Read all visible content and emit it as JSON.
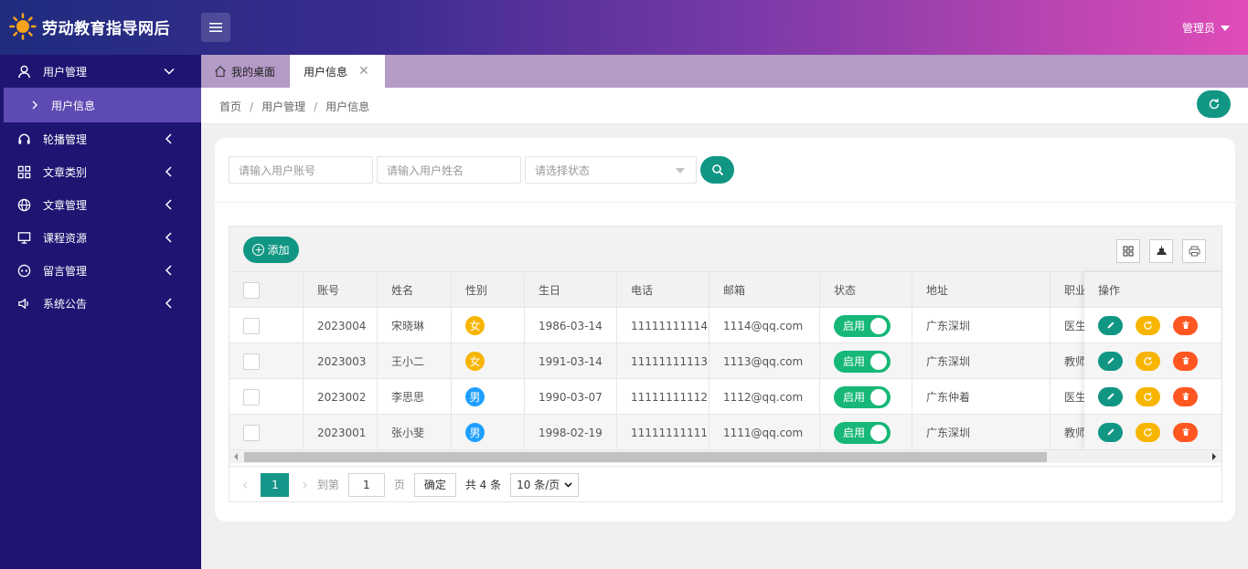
{
  "header": {
    "logo_text": "劳动教育指导网后",
    "admin_label": "管理员",
    "brand_gradient": [
      "#1f2c7e",
      "#e04cb8"
    ]
  },
  "sidebar": {
    "groups": [
      {
        "label": "用户管理",
        "icon": "user-icon",
        "expanded": true
      },
      {
        "label": "轮播管理",
        "icon": "headset-icon"
      },
      {
        "label": "文章类别",
        "icon": "grid-icon"
      },
      {
        "label": "文章管理",
        "icon": "globe-icon"
      },
      {
        "label": "课程资源",
        "icon": "monitor-icon"
      },
      {
        "label": "留言管理",
        "icon": "game-icon"
      },
      {
        "label": "系统公告",
        "icon": "speaker-icon"
      }
    ],
    "sub_item": "用户信息"
  },
  "tabs": {
    "home": "我的桌面",
    "active": "用户信息",
    "close": "✕"
  },
  "breadcrumb": {
    "items": [
      "首页",
      "用户管理",
      "用户信息"
    ],
    "sep": "/"
  },
  "search": {
    "account_placeholder": "请输入用户账号",
    "name_placeholder": "请输入用户姓名",
    "status_placeholder": "请选择状态"
  },
  "toolbar": {
    "add_label": "添加"
  },
  "table": {
    "columns": [
      "账号",
      "姓名",
      "性别",
      "生日",
      "电话",
      "邮箱",
      "状态",
      "地址",
      "职业",
      "操作"
    ],
    "rows": [
      {
        "account": "2023004",
        "name": "宋晓琳",
        "gender": "女",
        "birthday": "1986-03-14",
        "phone": "11111111114",
        "email": "1114@qq.com",
        "status": "启用",
        "address": "广东深圳",
        "job": "医生"
      },
      {
        "account": "2023003",
        "name": "王小二",
        "gender": "女",
        "birthday": "1991-03-14",
        "phone": "11111111113",
        "email": "1113@qq.com",
        "status": "启用",
        "address": "广东深圳",
        "job": "教师"
      },
      {
        "account": "2023002",
        "name": "李思思",
        "gender": "男",
        "birthday": "1990-03-07",
        "phone": "11111111112",
        "email": "1112@qq.com",
        "status": "启用",
        "address": "广东仲着",
        "job": "医生"
      },
      {
        "account": "2023001",
        "name": "张小斐",
        "gender": "男",
        "birthday": "1998-02-19",
        "phone": "11111111111",
        "email": "1111@qq.com",
        "status": "启用",
        "address": "广东深圳",
        "job": "教师"
      }
    ]
  },
  "pager": {
    "prev": "‹",
    "current": "1",
    "next": "›",
    "goto_label": "到第",
    "goto_value": "1",
    "page_unit": "页",
    "confirm": "确定",
    "total": "共 4 条",
    "page_size": "10 条/页"
  },
  "colors": {
    "accent": "#119684",
    "female": "#f8b500",
    "male": "#1e9fff",
    "toggle_on": "#16b777",
    "edit": "#119684",
    "reset": "#f8b500",
    "delete": "#ff5722"
  }
}
